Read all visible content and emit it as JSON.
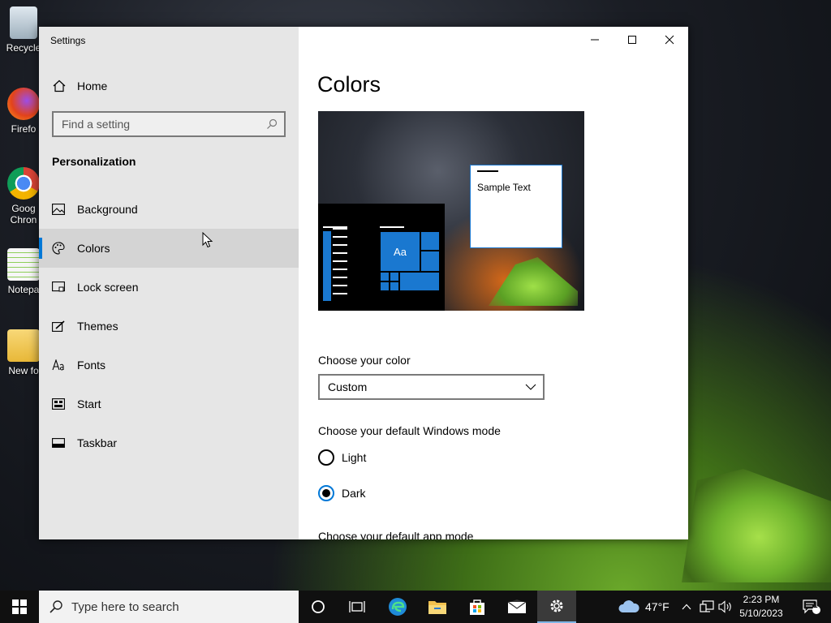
{
  "desktop": {
    "icons": [
      {
        "label": "Recycle"
      },
      {
        "label": "Firefo"
      },
      {
        "label": "Goog\nChron"
      },
      {
        "label": "Notepa"
      },
      {
        "label": "New fo"
      }
    ]
  },
  "window": {
    "title": "Settings",
    "controls": {
      "minimize": "minimize",
      "maximize": "maximize",
      "close": "close"
    }
  },
  "sidebar": {
    "home_label": "Home",
    "search_placeholder": "Find a setting",
    "section_title": "Personalization",
    "items": [
      {
        "label": "Background",
        "icon": "picture-icon"
      },
      {
        "label": "Colors",
        "icon": "palette-icon",
        "selected": true
      },
      {
        "label": "Lock screen",
        "icon": "lock-screen-icon"
      },
      {
        "label": "Themes",
        "icon": "brush-icon"
      },
      {
        "label": "Fonts",
        "icon": "font-icon"
      },
      {
        "label": "Start",
        "icon": "start-icon"
      },
      {
        "label": "Taskbar",
        "icon": "taskbar-icon"
      }
    ]
  },
  "main": {
    "page_title": "Colors",
    "preview": {
      "tile_text": "Aa",
      "sample_text": "Sample Text"
    },
    "choose_color_label": "Choose your color",
    "color_select_value": "Custom",
    "windows_mode_label": "Choose your default Windows mode",
    "windows_mode_options": [
      {
        "label": "Light",
        "checked": false
      },
      {
        "label": "Dark",
        "checked": true
      }
    ],
    "app_mode_label": "Choose your default app mode"
  },
  "taskbar": {
    "search_placeholder": "Type here to search",
    "weather_temp": "47°F",
    "time": "2:23 PM",
    "date": "5/10/2023",
    "notification_count": "1"
  },
  "colors": {
    "accent": "#0078d7",
    "sidebar_bg": "#e6e6e6",
    "taskbar_bg": "#101010"
  }
}
